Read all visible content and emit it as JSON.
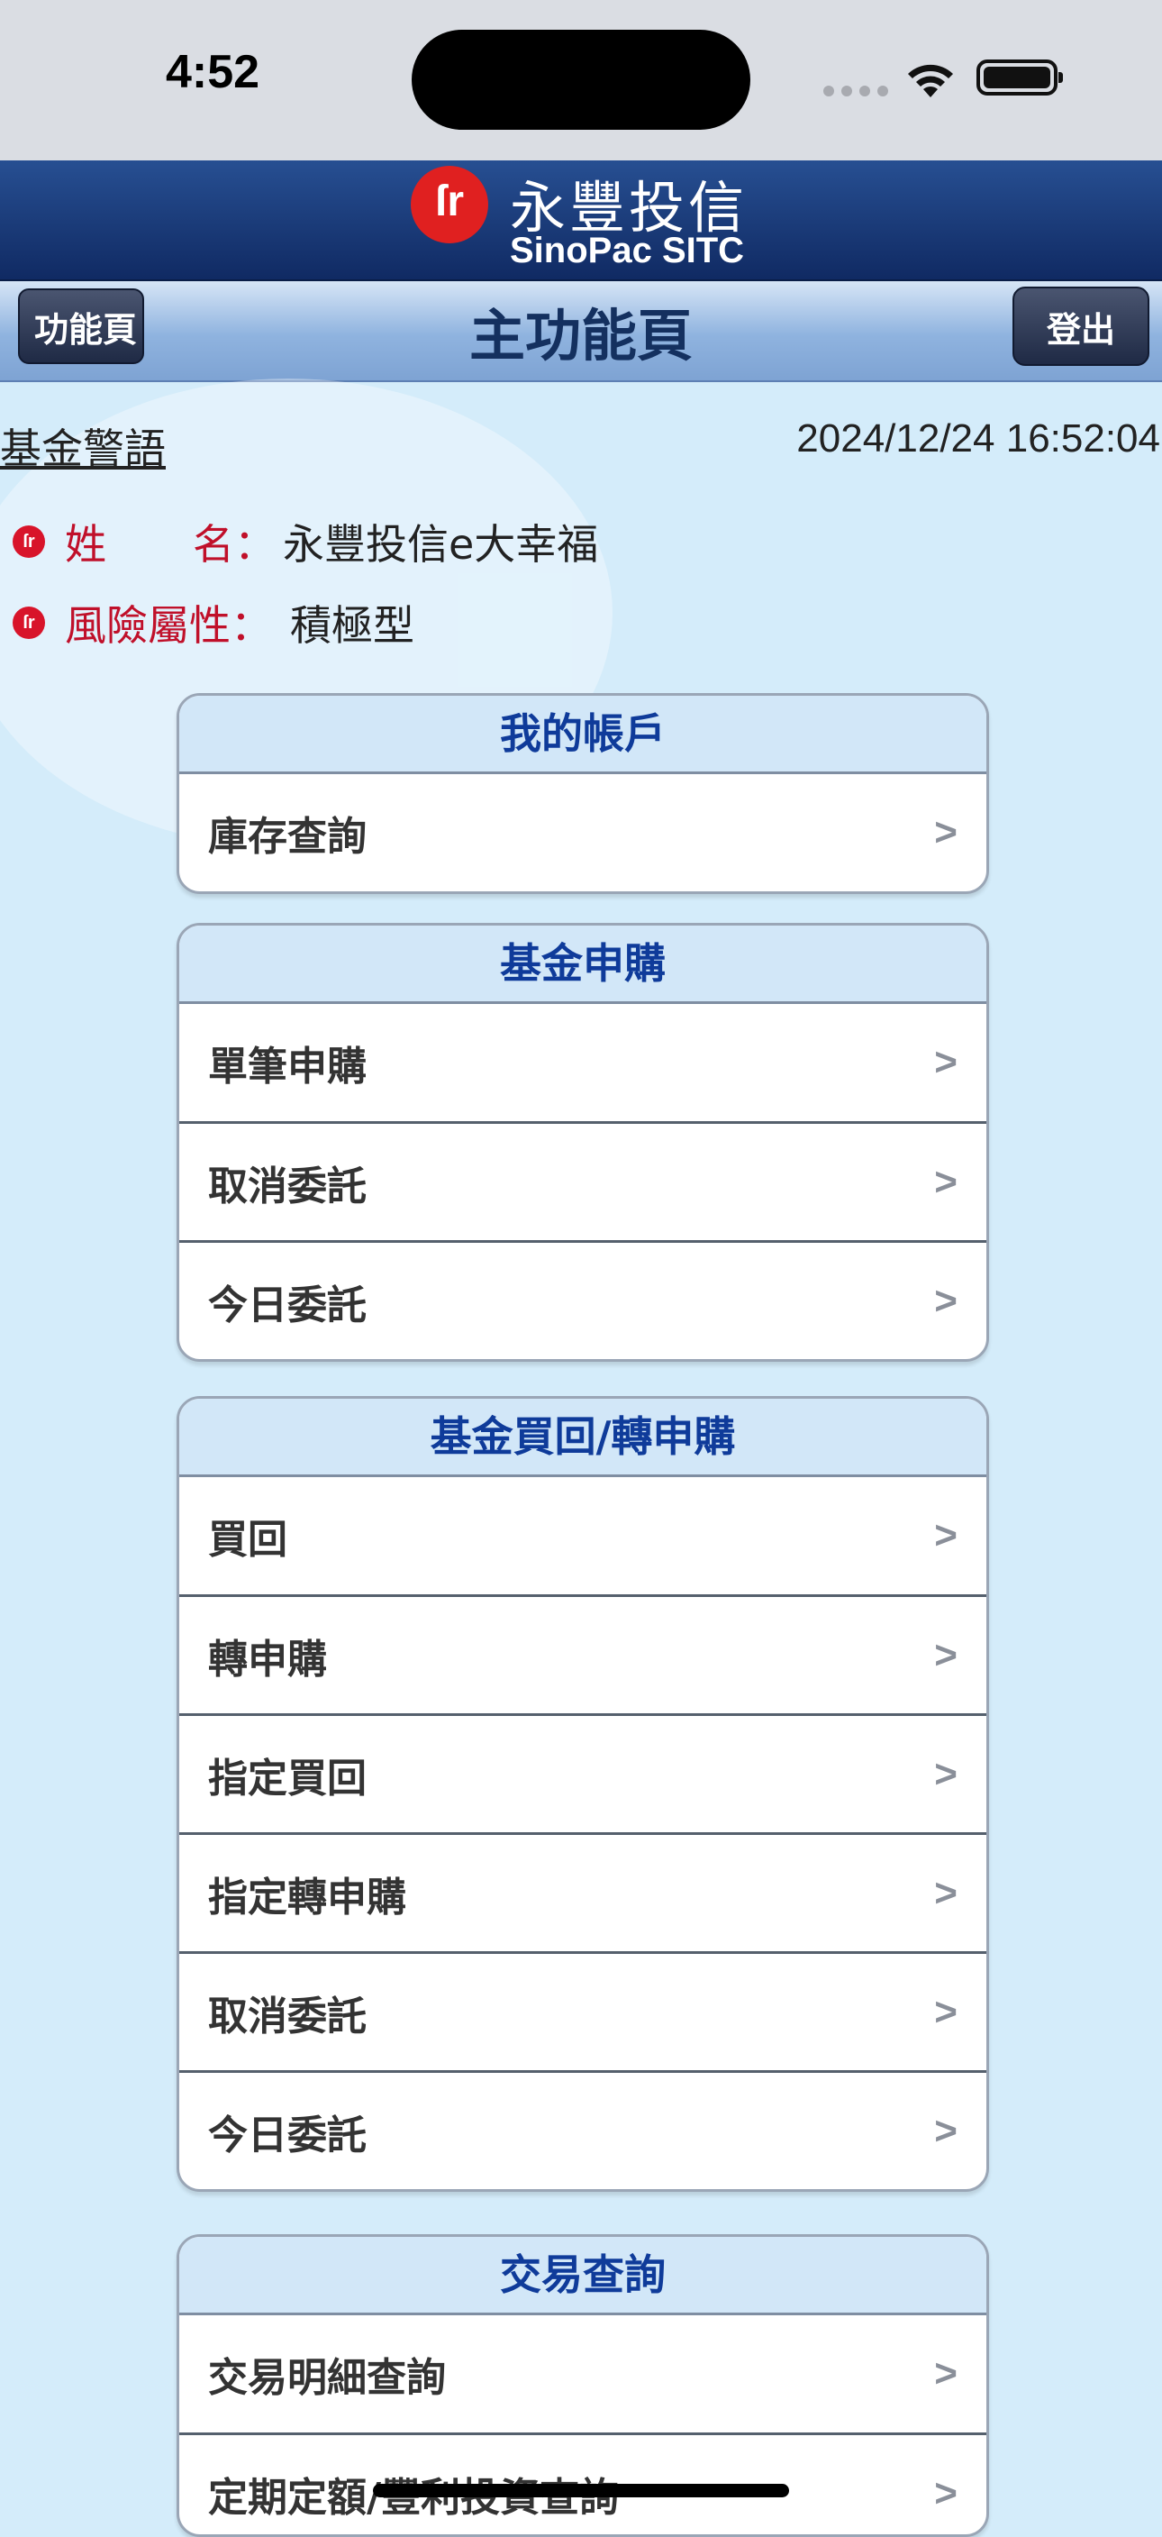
{
  "status_bar": {
    "time": "4:52"
  },
  "brand": {
    "name_cn": "永豐投信",
    "name_en": "SinoPac SITC",
    "logo_mark": "ſr"
  },
  "nav": {
    "back_label": "功能頁",
    "title": "主功能頁",
    "logout_label": "登出"
  },
  "info": {
    "warning_link": "基金警語",
    "datetime": "2024/12/24 16:52:04",
    "name_label": "姓名",
    "name_value": "永豐投信e大幸福",
    "risk_label": "風險屬性",
    "risk_value": "積極型",
    "colon": "："
  },
  "groups": [
    {
      "title": "我的帳戶",
      "items": [
        "庫存查詢"
      ]
    },
    {
      "title": "基金申購",
      "items": [
        "單筆申購",
        "取消委託",
        "今日委託"
      ]
    },
    {
      "title": "基金買回/轉申購",
      "items": [
        "買回",
        "轉申購",
        "指定買回",
        "指定轉申購",
        "取消委託",
        "今日委託"
      ]
    },
    {
      "title": "交易查詢",
      "items": [
        "交易明細查詢",
        "定期定額/豐利投資查詢"
      ]
    }
  ],
  "chevron": ">",
  "colors": {
    "header_blue": "#102a63",
    "accent_red": "#d8142a",
    "group_title": "#0f3b9a",
    "background": "#d4ecfa"
  }
}
